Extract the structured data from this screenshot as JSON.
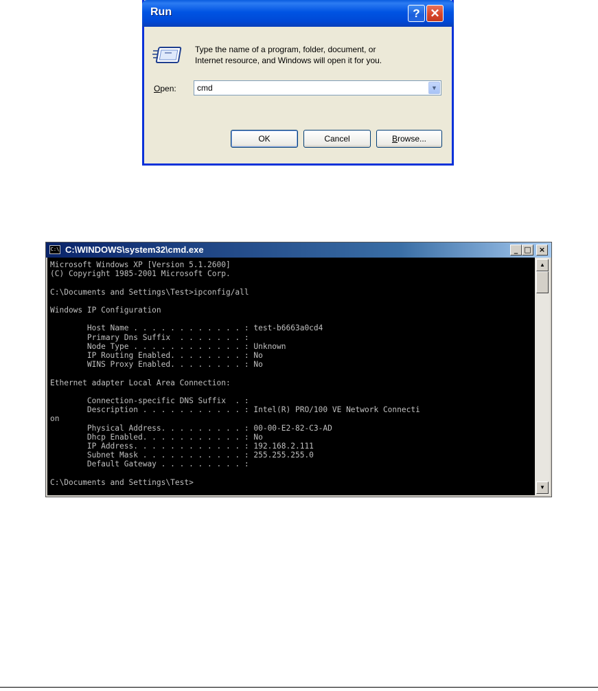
{
  "run_dialog": {
    "title": "Run",
    "help_glyph": "?",
    "close_glyph": "✕",
    "description_line1": "Type the name of a program, folder, document, or",
    "description_line2": "Internet resource, and Windows will open it for you.",
    "open_label_mnemonic": "O",
    "open_label_rest": "pen:",
    "open_value": "cmd",
    "dropdown_glyph": "▼",
    "ok_label": "OK",
    "cancel_label": "Cancel",
    "browse_mnemonic": "B",
    "browse_rest": "rowse..."
  },
  "cmd_window": {
    "icon_text": "C:\\",
    "title": "C:\\WINDOWS\\system32\\cmd.exe",
    "minimize_glyph": "_",
    "maximize_glyph": "□",
    "close_glyph": "×",
    "scroll_up_glyph": "▲",
    "scroll_down_glyph": "▼",
    "console_lines": [
      "Microsoft Windows XP [Version 5.1.2600]",
      "(C) Copyright 1985-2001 Microsoft Corp.",
      "",
      "C:\\Documents and Settings\\Test>ipconfig/all",
      "",
      "Windows IP Configuration",
      "",
      "        Host Name . . . . . . . . . . . . : test-b6663a0cd4",
      "        Primary Dns Suffix  . . . . . . . :",
      "        Node Type . . . . . . . . . . . . : Unknown",
      "        IP Routing Enabled. . . . . . . . : No",
      "        WINS Proxy Enabled. . . . . . . . : No",
      "",
      "Ethernet adapter Local Area Connection:",
      "",
      "        Connection-specific DNS Suffix  . :",
      "        Description . . . . . . . . . . . : Intel(R) PRO/100 VE Network Connecti",
      "on",
      "        Physical Address. . . . . . . . . : 00-00-E2-82-C3-AD",
      "        Dhcp Enabled. . . . . . . . . . . : No",
      "        IP Address. . . . . . . . . . . . : 192.168.2.111",
      "        Subnet Mask . . . . . . . . . . . : 255.255.255.0",
      "        Default Gateway . . . . . . . . . :",
      "",
      "C:\\Documents and Settings\\Test>"
    ]
  }
}
